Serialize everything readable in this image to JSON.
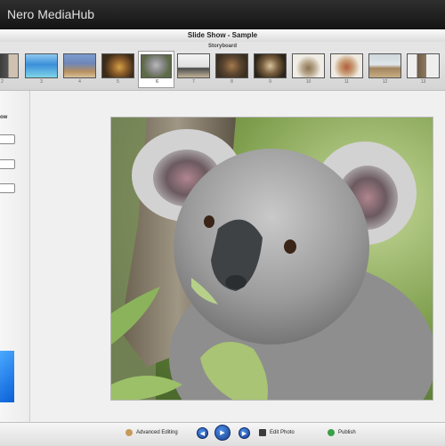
{
  "app": {
    "title": "Nero MediaHub"
  },
  "window": {
    "caption": "Slide Show - Sample"
  },
  "storyboard": {
    "label": "Storyboard",
    "thumbnails": [
      {
        "num": "2",
        "colors": [
          "#5b4c3f",
          "#c9b8a3"
        ]
      },
      {
        "num": "3",
        "colors": [
          "#3a8fd9",
          "#7fd4e8"
        ]
      },
      {
        "num": "4",
        "colors": [
          "#6e86b8",
          "#b79060"
        ]
      },
      {
        "num": "5",
        "colors": [
          "#3c2b19",
          "#d4a248"
        ]
      },
      {
        "num": "6",
        "colors": [
          "#6e6e6e",
          "#a8a8a8"
        ]
      },
      {
        "num": "7",
        "colors": [
          "#e9e9e9",
          "#4a4a4a"
        ]
      },
      {
        "num": "8",
        "colors": [
          "#3a2f22",
          "#a37a4d"
        ]
      },
      {
        "num": "9",
        "colors": [
          "#2c2418",
          "#d9c4a0"
        ]
      },
      {
        "num": "10",
        "colors": [
          "#f0ede6",
          "#8a7354"
        ]
      },
      {
        "num": "11",
        "colors": [
          "#efebe3",
          "#b35c3c"
        ]
      },
      {
        "num": "12",
        "colors": [
          "#cfd8dc",
          "#a3855f"
        ]
      },
      {
        "num": "13",
        "colors": [
          "#eeeeee",
          "#6b5a47"
        ]
      }
    ]
  },
  "left_panel": {
    "label": "ow"
  },
  "toolbar": {
    "advanced_editing": "Advanced Editing",
    "edit_photo": "Edit Photo",
    "publish": "Publish"
  }
}
